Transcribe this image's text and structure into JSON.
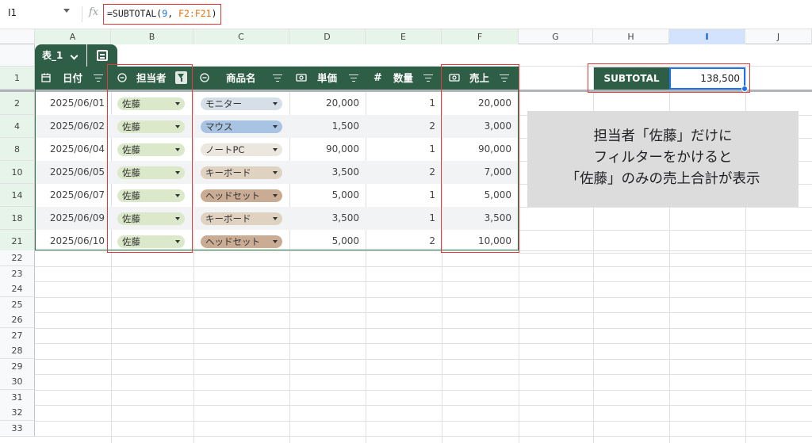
{
  "formula_bar": {
    "cell_ref": "I1",
    "fx": "fx",
    "formula_prefix": "=SUBTOTAL(",
    "formula_arg1": "9",
    "formula_sep": ", ",
    "formula_range": "F2:F21",
    "formula_suffix": ")"
  },
  "columns": [
    "A",
    "B",
    "C",
    "D",
    "E",
    "F",
    "G",
    "H",
    "I",
    "J"
  ],
  "table": {
    "name": "表_1",
    "headers": [
      "日付",
      "担当者",
      "商品名",
      "単価",
      "数量",
      "売上"
    ],
    "qty_symbol": "#",
    "rows": [
      {
        "row": "2",
        "date": "2025/06/01",
        "person": "佐藤",
        "product": "モニター",
        "price": "20,000",
        "qty": "1",
        "sales": "20,000"
      },
      {
        "row": "4",
        "date": "2025/06/02",
        "person": "佐藤",
        "product": "マウス",
        "price": "1,500",
        "qty": "2",
        "sales": "3,000"
      },
      {
        "row": "8",
        "date": "2025/06/04",
        "person": "佐藤",
        "product": "ノートPC",
        "price": "90,000",
        "qty": "1",
        "sales": "90,000"
      },
      {
        "row": "10",
        "date": "2025/06/05",
        "person": "佐藤",
        "product": "キーボード",
        "price": "3,500",
        "qty": "2",
        "sales": "7,000"
      },
      {
        "row": "14",
        "date": "2025/06/07",
        "person": "佐藤",
        "product": "ヘッドセット",
        "price": "5,000",
        "qty": "1",
        "sales": "5,000"
      },
      {
        "row": "18",
        "date": "2025/06/09",
        "person": "佐藤",
        "product": "キーボード",
        "price": "3,500",
        "qty": "1",
        "sales": "3,500"
      },
      {
        "row": "21",
        "date": "2025/06/10",
        "person": "佐藤",
        "product": "ヘッドセット",
        "price": "5,000",
        "qty": "2",
        "sales": "10,000"
      }
    ]
  },
  "header_row": "1",
  "empty_rows": [
    "22",
    "23",
    "24",
    "25",
    "26",
    "27",
    "28",
    "29",
    "30",
    "31",
    "32",
    "33"
  ],
  "subtotal": {
    "label": "SUBTOTAL",
    "value": "138,500"
  },
  "note": {
    "line1": "担当者「佐藤」だけに",
    "line2": "フィルターをかけると",
    "line3": "「佐藤」のみの売上合計が表示"
  },
  "colors": {
    "table_header": "#2e5e46",
    "highlight": "#e53935",
    "selection": "#1a73e8",
    "person_chip": "#dbe8c9",
    "product_chips": {
      "モニター": "#d6dee8",
      "マウス": "#a9c4e3",
      "ノートPC": "#ece7de",
      "キーボード": "#e0d2c0",
      "ヘッドセット": "#c9ac93"
    }
  }
}
